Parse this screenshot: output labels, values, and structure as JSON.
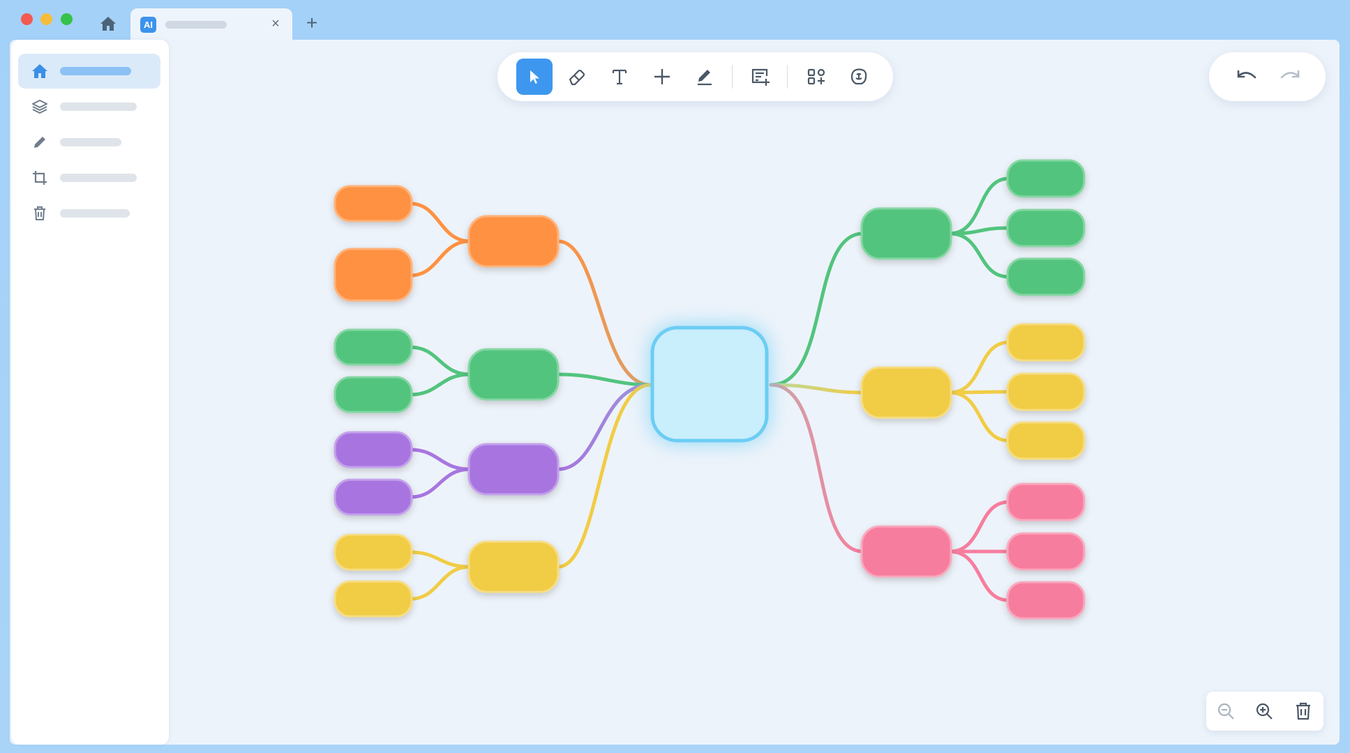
{
  "window": {
    "tab": {
      "badge": "AI",
      "title": ""
    },
    "new_tab_label": "+",
    "close_label": "×"
  },
  "sidebar": {
    "items": [
      {
        "icon": "home-icon",
        "label": "",
        "active": true
      },
      {
        "icon": "layers-icon",
        "label": "",
        "active": false
      },
      {
        "icon": "pencil-icon",
        "label": "",
        "active": false
      },
      {
        "icon": "crop-icon",
        "label": "",
        "active": false
      },
      {
        "icon": "trash-icon",
        "label": "",
        "active": false
      }
    ]
  },
  "toolbar": {
    "tools": [
      "select-tool",
      "eraser-tool",
      "text-tool",
      "add-tool",
      "pen-tool",
      "note-tool",
      "components-tool",
      "ai-tool"
    ],
    "active_tool": "select-tool"
  },
  "history": [
    "undo",
    "redo"
  ],
  "zoom_controls": [
    "zoom-out",
    "zoom-in",
    "delete"
  ],
  "colors": {
    "accent": "#3e97ef",
    "orange": "#ff9142",
    "green": "#52c47e",
    "purple": "#a875e0",
    "yellow": "#f1cc45",
    "pink": "#f77d9e",
    "center": "#c9eefc"
  },
  "mindmap": {
    "center_node": {
      "label": ""
    },
    "left_branches": [
      {
        "color": "orange",
        "children": 2
      },
      {
        "color": "green",
        "children": 2
      },
      {
        "color": "purple",
        "children": 2
      },
      {
        "color": "yellow",
        "children": 2
      }
    ],
    "right_branches": [
      {
        "color": "green",
        "children": 3
      },
      {
        "color": "yellow",
        "children": 3
      },
      {
        "color": "pink",
        "children": 3
      }
    ]
  }
}
